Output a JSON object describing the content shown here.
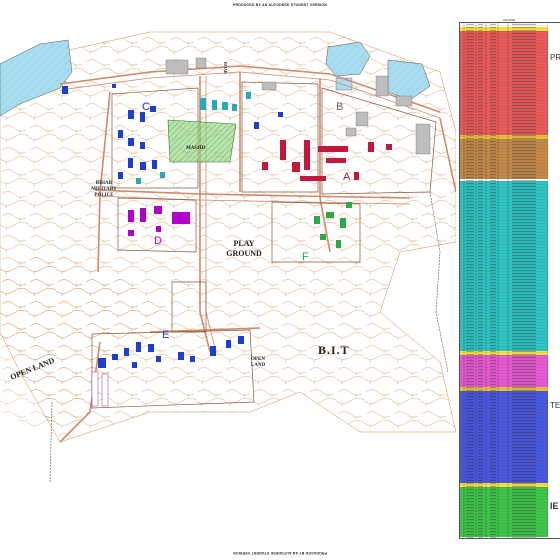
{
  "header": {
    "top_banner": "PRODUCED BY AN AUTODESK STUDENT VERSION"
  },
  "footer": {
    "bottom_banner": "PRODUCED BY AN AUTODESK STUDENT VERSION"
  },
  "map": {
    "labels": {
      "masjid": "MASJID",
      "bihar_military_police": [
        "BIHAR",
        "MILITARY",
        "POLICE"
      ],
      "play_ground": [
        "PLAY",
        "GROUND"
      ],
      "bit": "B.I.T",
      "open_land_left": "OPEN LAND",
      "open_land_right": [
        "OPEN",
        "LAND"
      ],
      "road_left": "ROAD"
    },
    "zone_letters": [
      "A",
      "B",
      "C",
      "D",
      "E",
      "F"
    ],
    "colors": {
      "road": "#d08a6a",
      "water": "#a9dcef",
      "building_blue": "#1d3fd1",
      "building_cyan": "#27a9b8",
      "building_red": "#c2183c",
      "building_magenta": "#b000c9",
      "building_green": "#2aa84a",
      "masjid_fill": "#8ed47b",
      "contour": "#d98b4f"
    }
  },
  "legend": {
    "title": "LEGEND",
    "side_text": [
      "PR",
      "TE",
      "IE"
    ],
    "bands": [
      {
        "color": "#ffe23a",
        "label_color": "#e8c400"
      },
      {
        "color": "#ec5a5a"
      },
      {
        "color": "#e8c43a"
      },
      {
        "color": "#c58a4a"
      },
      {
        "color": "#2ec5c5"
      },
      {
        "color": "#ffe23a"
      },
      {
        "color": "#e85ad2"
      },
      {
        "color": "#e8c43a"
      },
      {
        "color": "#4a58e0"
      },
      {
        "color": "#ffe23a"
      },
      {
        "color": "#3ec84a"
      }
    ]
  }
}
